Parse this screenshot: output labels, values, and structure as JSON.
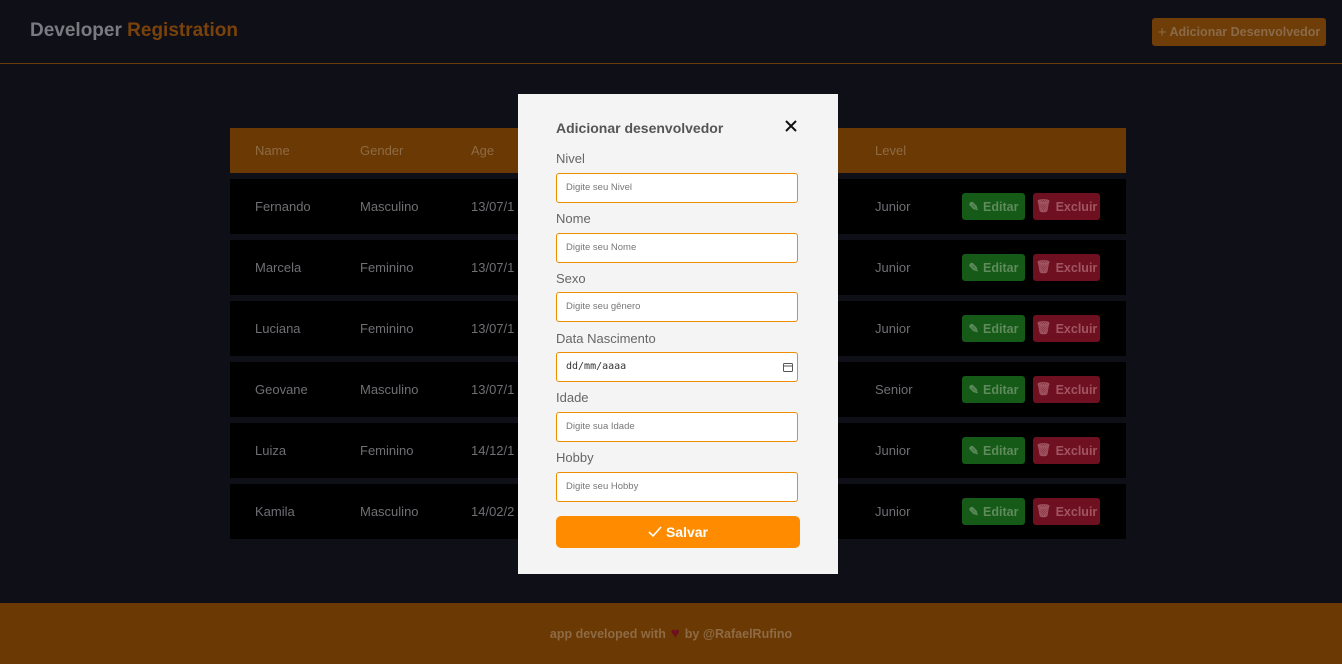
{
  "header": {
    "brand_part1": "Developer",
    "brand_part2": "Registration",
    "add_button_label": "Adicionar Desenvolvedor"
  },
  "table": {
    "columns": [
      "Name",
      "Gender",
      "Age",
      "Level"
    ],
    "rows": [
      {
        "name": "Fernando",
        "gender": "Masculino",
        "age": "13/07/1",
        "level": "Junior"
      },
      {
        "name": "Marcela",
        "gender": "Feminino",
        "age": "13/07/1",
        "level": "Junior"
      },
      {
        "name": "Luciana",
        "gender": "Feminino",
        "age": "13/07/1",
        "level": "Junior"
      },
      {
        "name": "Geovane",
        "gender": "Masculino",
        "age": "13/07/1",
        "level": "Senior"
      },
      {
        "name": "Luiza",
        "gender": "Feminino",
        "age": "14/12/1",
        "level": "Junior"
      },
      {
        "name": "Kamila",
        "gender": "Masculino",
        "age": "14/02/2",
        "level": "Junior"
      }
    ],
    "edit_label": "Editar",
    "delete_label": "Excluir"
  },
  "modal": {
    "title": "Adicionar desenvolvedor",
    "fields": [
      {
        "label": "Nivel",
        "placeholder": "Digite seu Nivel"
      },
      {
        "label": "Nome",
        "placeholder": "Digite seu Nome"
      },
      {
        "label": "Sexo",
        "placeholder": "Digite seu gênero"
      },
      {
        "label": "Data Nascimento",
        "placeholder": "dd/mm/aaaa"
      },
      {
        "label": "Idade",
        "placeholder": "Digite sua Idade"
      },
      {
        "label": "Hobby",
        "placeholder": "Digite seu Hobby"
      }
    ],
    "save_label": "Salvar"
  },
  "footer": {
    "text_before": "app developed with",
    "text_after": "by @RafaelRufino"
  },
  "colors": {
    "accent": "#ff8c00",
    "edit": "#165a18",
    "delete": "#6e1020"
  }
}
